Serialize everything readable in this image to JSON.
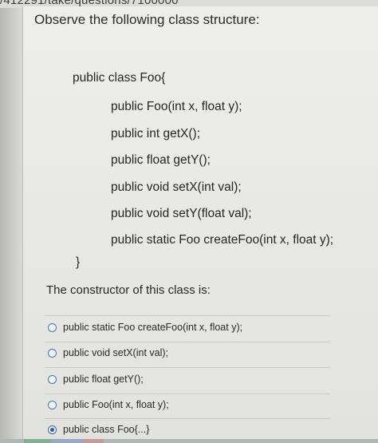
{
  "browser": {
    "url_fragment": "/412291/take/questions/7100000"
  },
  "question": {
    "title": "Observe the following class structure:",
    "code_lines": [
      "public class Foo{",
      "public Foo(int x, float y);",
      "public int getX();",
      "public float getY();",
      "public void setX(int val);",
      "public void setY(float val);",
      "public static Foo createFoo(int x, float y);",
      "}"
    ],
    "prompt": "The constructor of this class is:",
    "options": [
      {
        "label": "public static Foo createFoo(int x, float y);",
        "selected": false
      },
      {
        "label": "public void setX(int val);",
        "selected": false
      },
      {
        "label": "public float getY();",
        "selected": false
      },
      {
        "label": "public Foo(int x, float y);",
        "selected": false
      },
      {
        "label": "public class Foo{...}",
        "selected": true
      }
    ]
  },
  "colors": {
    "radio_accent": "#2c62b8",
    "panel_background": "#ececE8"
  }
}
